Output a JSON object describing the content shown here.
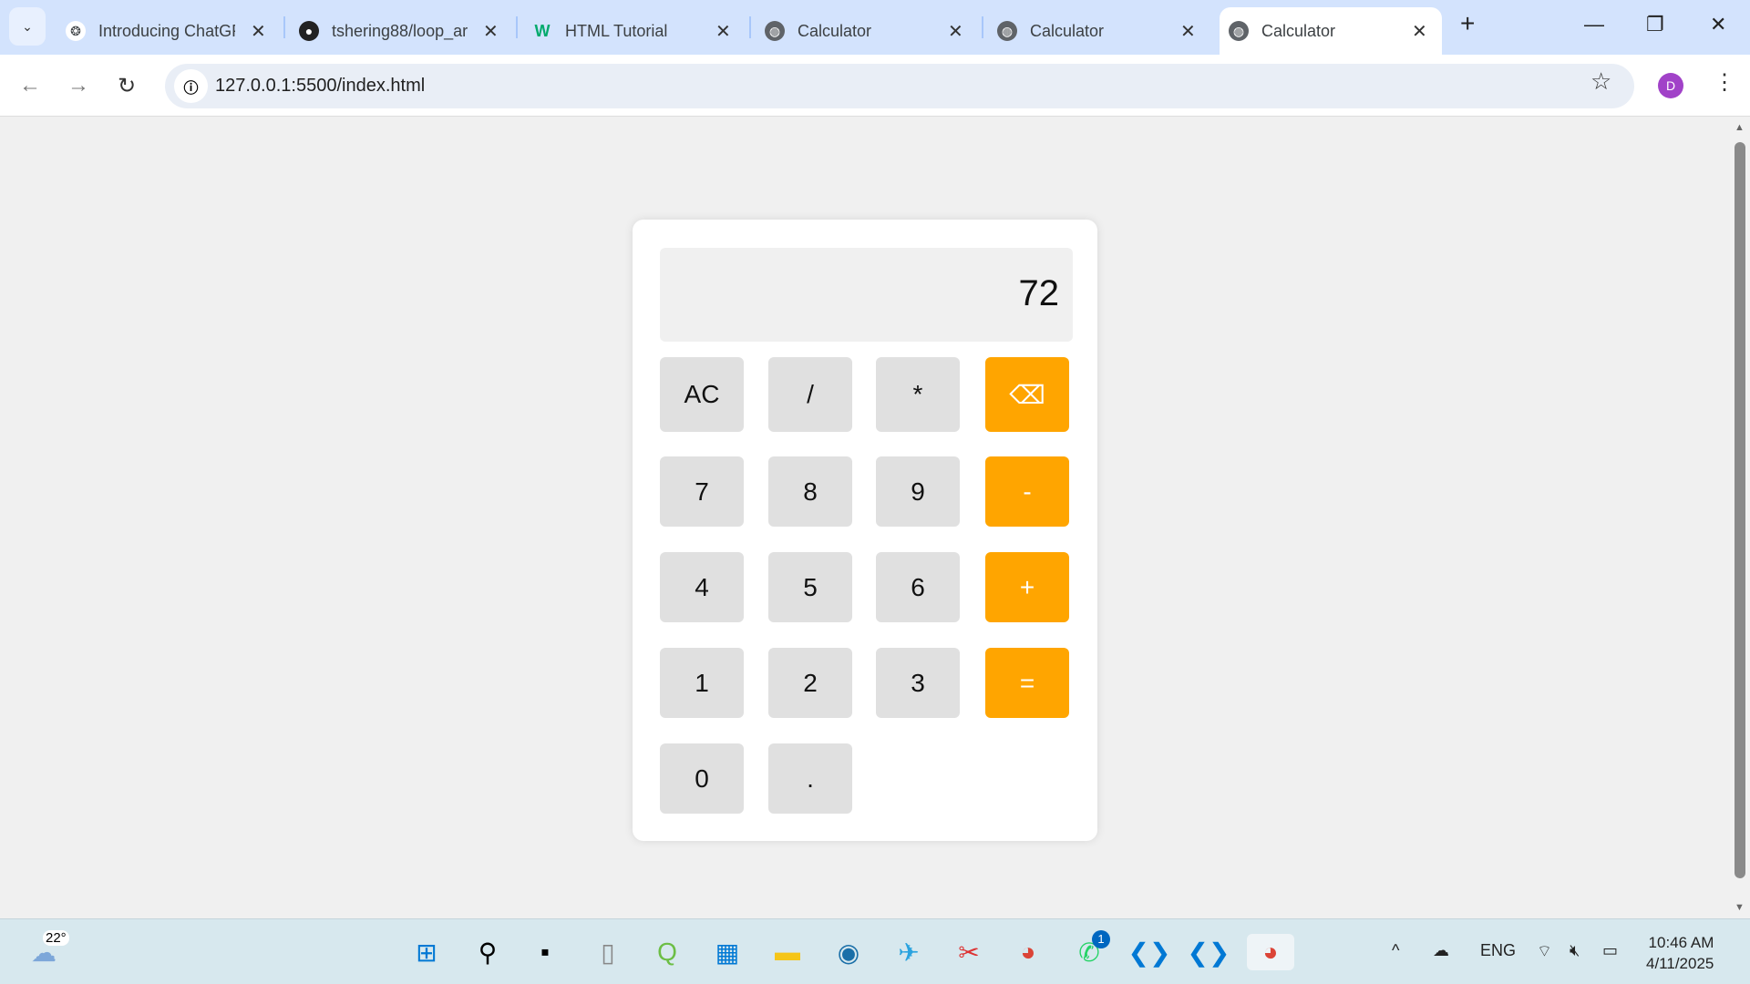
{
  "browser": {
    "tabs": [
      {
        "title": "Introducing ChatGPT",
        "icon": "openai-icon"
      },
      {
        "title": "tshering88/loop_ar",
        "icon": "github-icon"
      },
      {
        "title": "HTML Tutorial",
        "icon": "w3schools-icon"
      },
      {
        "title": "Calculator",
        "icon": "globe-icon"
      },
      {
        "title": "Calculator",
        "icon": "globe-icon"
      },
      {
        "title": "Calculator",
        "icon": "globe-icon",
        "active": true
      }
    ],
    "url": "127.0.0.1:5500/index.html",
    "profile_initial": "D"
  },
  "calculator": {
    "display": "72",
    "buttons": {
      "ac": "AC",
      "divide": "/",
      "multiply": "*",
      "backspace": "⌫",
      "seven": "7",
      "eight": "8",
      "nine": "9",
      "minus": "-",
      "four": "4",
      "five": "5",
      "six": "6",
      "plus": "+",
      "one": "1",
      "two": "2",
      "three": "3",
      "equals": "=",
      "zero": "0",
      "dot": "."
    },
    "colors": {
      "operator": "#ffa500",
      "key": "#e0e0e0",
      "display_bg": "#f0f0f0"
    }
  },
  "taskbar": {
    "weather_temp": "22°",
    "whatsapp_badge": "1",
    "language": "ENG",
    "time": "10:46 AM",
    "date": "4/11/2025"
  }
}
